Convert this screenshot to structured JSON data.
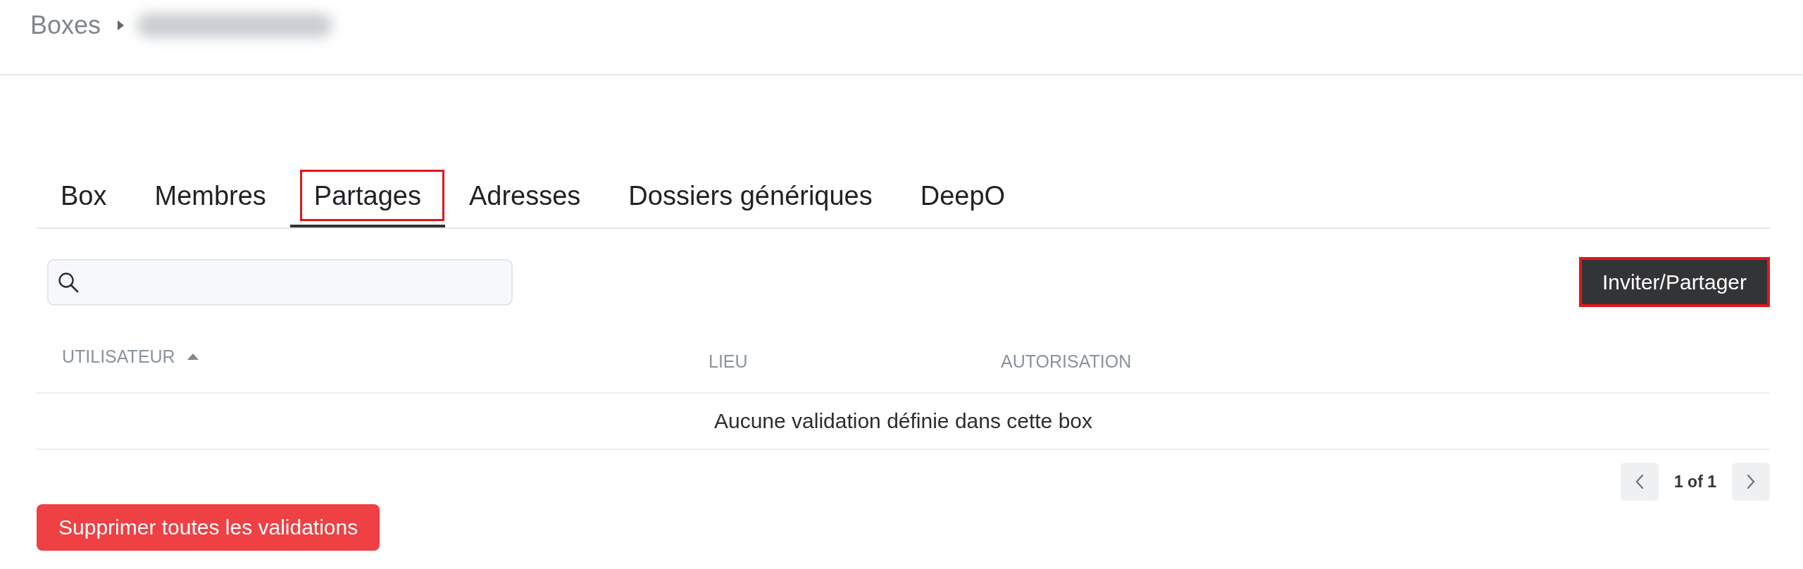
{
  "breadcrumb": [
    {
      "kind": "link",
      "label": "Boxes"
    },
    {
      "kind": "redacted"
    }
  ],
  "tabs": [
    {
      "label": "Box",
      "selected": false,
      "highlighted": false
    },
    {
      "label": "Membres",
      "selected": false,
      "highlighted": false
    },
    {
      "label": "Partages",
      "selected": true,
      "highlighted": true
    },
    {
      "label": "Adresses",
      "selected": false,
      "highlighted": false
    },
    {
      "label": "Dossiers génériques",
      "selected": false,
      "highlighted": false
    },
    {
      "label": "DeepO",
      "selected": false,
      "highlighted": false
    }
  ],
  "toolbar": {
    "has_search": true,
    "action": {
      "label": "Inviter/Partager",
      "highlighted": true
    }
  },
  "table": {
    "columns": [
      {
        "label": "UTILISATEUR",
        "sorted": true
      },
      {
        "label": "LIEU",
        "sorted": false
      },
      {
        "label": "AUTORISATION",
        "sorted": false
      }
    ],
    "empty_message": "Aucune validation définie dans cette box"
  },
  "pagination": {
    "label": "1 of 1"
  },
  "footer_button": {
    "label": "Supprimer toutes les validations",
    "kind": "danger"
  }
}
